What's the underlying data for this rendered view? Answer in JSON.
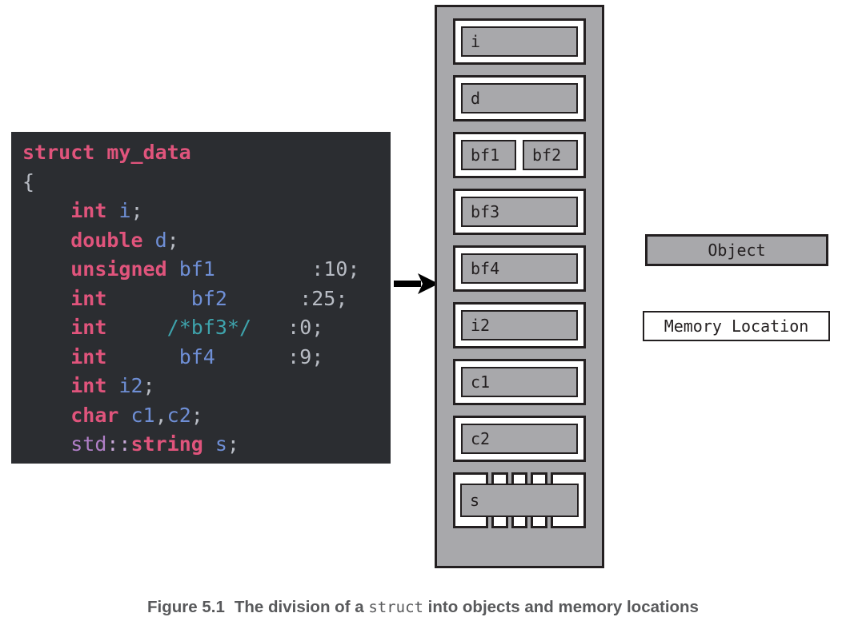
{
  "code": {
    "language": "cpp",
    "background": "#2b2d31",
    "lines": [
      [
        {
          "t": "struct",
          "c": "kw"
        },
        {
          "t": " ",
          "c": "punc"
        },
        {
          "t": "my_data",
          "c": "kw"
        }
      ],
      [
        {
          "t": "{",
          "c": "punc"
        }
      ],
      [
        {
          "t": "    ",
          "c": "punc"
        },
        {
          "t": "int",
          "c": "kw"
        },
        {
          "t": " ",
          "c": "punc"
        },
        {
          "t": "i",
          "c": "id"
        },
        {
          "t": ";",
          "c": "punc"
        }
      ],
      [
        {
          "t": "    ",
          "c": "punc"
        },
        {
          "t": "double",
          "c": "kw"
        },
        {
          "t": " ",
          "c": "punc"
        },
        {
          "t": "d",
          "c": "id"
        },
        {
          "t": ";",
          "c": "punc"
        }
      ],
      [
        {
          "t": "    ",
          "c": "punc"
        },
        {
          "t": "unsigned",
          "c": "kw"
        },
        {
          "t": " ",
          "c": "punc"
        },
        {
          "t": "bf1",
          "c": "id"
        },
        {
          "t": "        ",
          "c": "punc"
        },
        {
          "t": ":10;",
          "c": "num"
        }
      ],
      [
        {
          "t": "    ",
          "c": "punc"
        },
        {
          "t": "int",
          "c": "kw"
        },
        {
          "t": "       ",
          "c": "punc"
        },
        {
          "t": "bf2",
          "c": "id"
        },
        {
          "t": "      ",
          "c": "punc"
        },
        {
          "t": ":25;",
          "c": "num"
        }
      ],
      [
        {
          "t": "    ",
          "c": "punc"
        },
        {
          "t": "int",
          "c": "kw"
        },
        {
          "t": "     ",
          "c": "punc"
        },
        {
          "t": "/*bf3*/",
          "c": "cmt"
        },
        {
          "t": "   ",
          "c": "punc"
        },
        {
          "t": ":0;",
          "c": "num"
        }
      ],
      [
        {
          "t": "    ",
          "c": "punc"
        },
        {
          "t": "int",
          "c": "kw"
        },
        {
          "t": "      ",
          "c": "punc"
        },
        {
          "t": "bf4",
          "c": "id"
        },
        {
          "t": "      ",
          "c": "punc"
        },
        {
          "t": ":9;",
          "c": "num"
        }
      ],
      [
        {
          "t": "    ",
          "c": "punc"
        },
        {
          "t": "int",
          "c": "kw"
        },
        {
          "t": " ",
          "c": "punc"
        },
        {
          "t": "i2",
          "c": "id"
        },
        {
          "t": ";",
          "c": "punc"
        }
      ],
      [
        {
          "t": "    ",
          "c": "punc"
        },
        {
          "t": "char",
          "c": "kw"
        },
        {
          "t": " ",
          "c": "punc"
        },
        {
          "t": "c1",
          "c": "id"
        },
        {
          "t": ",",
          "c": "punc"
        },
        {
          "t": "c2",
          "c": "id"
        },
        {
          "t": ";",
          "c": "punc"
        }
      ],
      [
        {
          "t": "    ",
          "c": "punc"
        },
        {
          "t": "std",
          "c": "ns"
        },
        {
          "t": "::",
          "c": "colons"
        },
        {
          "t": "string",
          "c": "kw"
        },
        {
          "t": " ",
          "c": "punc"
        },
        {
          "t": "s",
          "c": "id"
        },
        {
          "t": ";",
          "c": "punc"
        }
      ],
      [
        {
          "t": "};",
          "c": "punc"
        }
      ]
    ]
  },
  "arrow": {
    "name": "right-arrow",
    "color": "#000000"
  },
  "memory_diagram": {
    "container_color": "#a8a8ab",
    "border_color": "#231f20",
    "rows": [
      {
        "kind": "single",
        "objects": [
          "i"
        ]
      },
      {
        "kind": "single",
        "objects": [
          "d"
        ]
      },
      {
        "kind": "split",
        "objects": [
          "bf1",
          "bf2"
        ]
      },
      {
        "kind": "single",
        "objects": [
          "bf3"
        ]
      },
      {
        "kind": "single",
        "objects": [
          "bf4"
        ]
      },
      {
        "kind": "single",
        "objects": [
          "i2"
        ]
      },
      {
        "kind": "single",
        "objects": [
          "c1"
        ]
      },
      {
        "kind": "single",
        "objects": [
          "c2"
        ]
      },
      {
        "kind": "segmented",
        "objects": [
          "s"
        ],
        "segments": [
          "wide",
          "narrow",
          "narrow",
          "narrow",
          "wide"
        ]
      }
    ]
  },
  "legend": {
    "object_label": "Object",
    "object_fill": "#a8a8ab",
    "memory_location_label": "Memory Location",
    "memory_location_fill": "#ffffff"
  },
  "caption": {
    "figure_number": "Figure 5.1",
    "text_before": "The division of a ",
    "code_term": "struct",
    "text_after": " into objects and memory locations",
    "color": "#58595b"
  }
}
